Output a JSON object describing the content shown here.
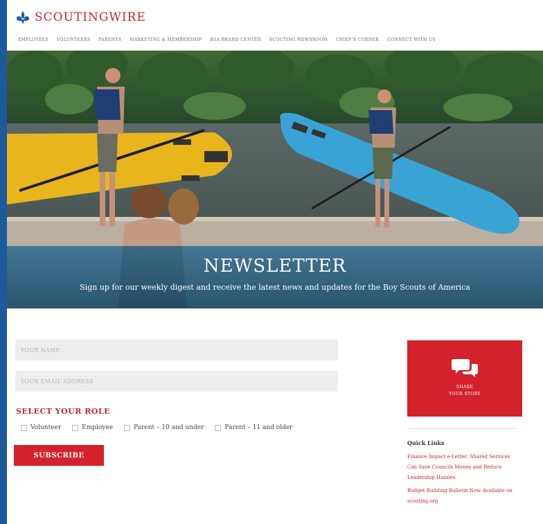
{
  "brand": {
    "logo_text": "SCOUTINGWIRE",
    "logo_icon": "fleur-de-lis-icon",
    "accent_color": "#c9252c"
  },
  "nav": {
    "items": [
      "EMPLOYEES",
      "VOLUNTEERS",
      "PARENTS",
      "MARKETING & MEMBERSHIP",
      "BSA BRAND CENTER",
      "SCOUTING NEWSROOM",
      "CHIEF'S CORNER",
      "CONNECT WITH US"
    ]
  },
  "hero": {
    "title": "NEWSLETTER",
    "subtitle": "Sign up for our weekly digest and receive the latest news and updates for the Boy Scouts of America"
  },
  "form": {
    "name_placeholder": "YOUR NAME",
    "email_placeholder": "YOUR EMAIL ADDRESS",
    "role_heading": "SELECT YOUR ROLE",
    "roles": [
      "Volunteer",
      "Employee",
      "Parent – 10 and under",
      "Parent – 11 and older"
    ],
    "subscribe_label": "SUBSCRIBE"
  },
  "sidebar": {
    "share_icon": "speech-bubbles-icon",
    "share_line1": "SHARE",
    "share_line2": "YOUR STORY",
    "quick_links_heading": "Quick Links",
    "quick_links": [
      "Finance Impact e-Letter: Shared Services Can Save Councils Money and Reduce Leadership Hassles",
      "Budget Building Bulletin Now Available on scouting.org"
    ]
  }
}
